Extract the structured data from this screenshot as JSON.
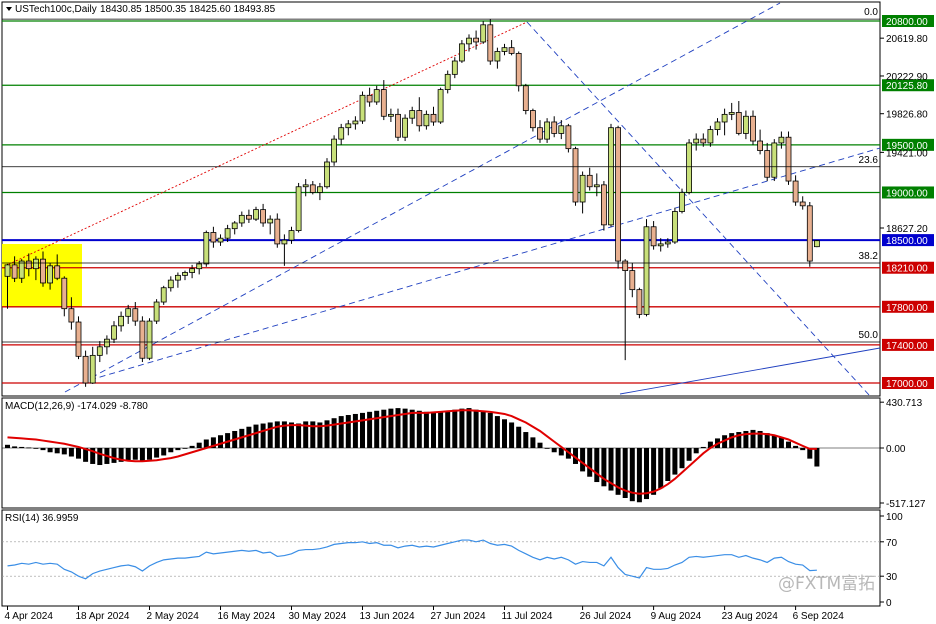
{
  "header": {
    "symbol": "USTech100c,Daily",
    "ohlc": "18430.85 18500.35 18425.60 18493.85"
  },
  "price_axis": {
    "ticks": [
      "20619.80",
      "20222.90",
      "19826.80",
      "19421.00",
      "18627.20"
    ]
  },
  "price_levels": [
    {
      "label": "20800.00",
      "value": 20800.0,
      "color": "#008000",
      "style": "green"
    },
    {
      "label": "20125.80",
      "value": 20125.8,
      "color": "#008000",
      "style": "green"
    },
    {
      "label": "19500.00",
      "value": 19500.0,
      "color": "#008000",
      "style": "green"
    },
    {
      "label": "19000.00",
      "value": 19000.0,
      "color": "#008000",
      "style": "green"
    },
    {
      "label": "18500.00",
      "value": 18500.0,
      "color": "#0000cd",
      "style": "blue"
    },
    {
      "label": "18210.00",
      "value": 18210.0,
      "color": "#cc0000",
      "style": "red"
    },
    {
      "label": "17800.00",
      "value": 17800.0,
      "color": "#cc0000",
      "style": "red"
    },
    {
      "label": "17400.00",
      "value": 17400.0,
      "color": "#cc0000",
      "style": "red"
    },
    {
      "label": "17000.00",
      "value": 17000.0,
      "color": "#cc0000",
      "style": "red"
    }
  ],
  "fib_levels": [
    {
      "label": "0.0",
      "value": 20820.0
    },
    {
      "label": "23.6",
      "value": 19270.0
    },
    {
      "label": "38.2",
      "value": 18260.0
    },
    {
      "label": "50.0",
      "value": 17430.0
    }
  ],
  "macd": {
    "title": "MACD(12,26,9) -174.029 -8.780",
    "ticks": [
      "430.713",
      "0.00",
      "-517.127"
    ],
    "ylim": [
      -600,
      500
    ]
  },
  "rsi": {
    "title": "RSI(14) 36.9959",
    "ticks": [
      "100",
      "70",
      "30",
      "0"
    ],
    "ylim": [
      0,
      100
    ]
  },
  "date_labels": [
    {
      "label": "4 Apr 2024",
      "index": 0
    },
    {
      "label": "18 Apr 2024",
      "index": 10
    },
    {
      "label": "2 May 2024",
      "index": 20
    },
    {
      "label": "16 May 2024",
      "index": 30
    },
    {
      "label": "30 May 2024",
      "index": 40
    },
    {
      "label": "13 Jun 2024",
      "index": 50
    },
    {
      "label": "27 Jun 2024",
      "index": 60
    },
    {
      "label": "11 Jul 2024",
      "index": 70
    },
    {
      "label": "26 Jul 2024",
      "index": 81
    },
    {
      "label": "9 Aug 2024",
      "index": 91
    },
    {
      "label": "23 Aug 2024",
      "index": 101
    },
    {
      "label": "6 Sep 2024",
      "index": 111
    }
  ],
  "watermark": "@FXTM富拓",
  "colors": {
    "bull": "#c8e07a",
    "bear": "#e8b090",
    "macd_signal": "#e00000",
    "rsi_line": "#3a8ee6",
    "highlight": "#ffff00"
  },
  "chart_data": {
    "type": "candlestick",
    "series": [
      {
        "name": "USTech100c,Daily",
        "values": [
          [
            18120,
            18250,
            17780,
            18240
          ],
          [
            18240,
            18330,
            18060,
            18100
          ],
          [
            18100,
            18300,
            18050,
            18280
          ],
          [
            18280,
            18360,
            18120,
            18200
          ],
          [
            18200,
            18330,
            18080,
            18300
          ],
          [
            18300,
            18380,
            18010,
            18050
          ],
          [
            18050,
            18260,
            17980,
            18230
          ],
          [
            18230,
            18350,
            18080,
            18100
          ],
          [
            18100,
            18120,
            17700,
            17780
          ],
          [
            17780,
            17900,
            17560,
            17640
          ],
          [
            17640,
            17700,
            17250,
            17280
          ],
          [
            17280,
            17340,
            16960,
            17000
          ],
          [
            17000,
            17380,
            16990,
            17290
          ],
          [
            17290,
            17440,
            17220,
            17380
          ],
          [
            17380,
            17500,
            17300,
            17460
          ],
          [
            17460,
            17650,
            17420,
            17600
          ],
          [
            17600,
            17750,
            17540,
            17700
          ],
          [
            17700,
            17820,
            17620,
            17780
          ],
          [
            17780,
            17850,
            17600,
            17650
          ],
          [
            17650,
            17700,
            17220,
            17260
          ],
          [
            17260,
            17680,
            17240,
            17650
          ],
          [
            17650,
            17880,
            17620,
            17850
          ],
          [
            17850,
            18020,
            17820,
            18000
          ],
          [
            18000,
            18120,
            17960,
            18080
          ],
          [
            18080,
            18160,
            18000,
            18130
          ],
          [
            18130,
            18180,
            18080,
            18160
          ],
          [
            18160,
            18240,
            18100,
            18200
          ],
          [
            18200,
            18280,
            18140,
            18250
          ],
          [
            18250,
            18600,
            18220,
            18580
          ],
          [
            18580,
            18640,
            18420,
            18480
          ],
          [
            18480,
            18560,
            18440,
            18520
          ],
          [
            18520,
            18660,
            18480,
            18620
          ],
          [
            18620,
            18700,
            18560,
            18680
          ],
          [
            18680,
            18800,
            18640,
            18760
          ],
          [
            18760,
            18820,
            18680,
            18720
          ],
          [
            18720,
            18850,
            18700,
            18820
          ],
          [
            18820,
            18880,
            18640,
            18680
          ],
          [
            18680,
            18760,
            18560,
            18720
          ],
          [
            18720,
            18780,
            18420,
            18460
          ],
          [
            18460,
            18560,
            18230,
            18500
          ],
          [
            18500,
            18640,
            18460,
            18600
          ],
          [
            18600,
            19100,
            18580,
            19060
          ],
          [
            19060,
            19140,
            18960,
            19080
          ],
          [
            19080,
            19120,
            18980,
            19000
          ],
          [
            19000,
            19100,
            18920,
            19060
          ],
          [
            19060,
            19360,
            19040,
            19320
          ],
          [
            19320,
            19600,
            19280,
            19560
          ],
          [
            19560,
            19720,
            19500,
            19680
          ],
          [
            19680,
            19760,
            19600,
            19720
          ],
          [
            19720,
            19800,
            19660,
            19750
          ],
          [
            19750,
            20060,
            19720,
            20020
          ],
          [
            20020,
            20100,
            19900,
            19950
          ],
          [
            19950,
            20120,
            19920,
            20080
          ],
          [
            20080,
            20180,
            19760,
            19800
          ],
          [
            19800,
            19880,
            19740,
            19820
          ],
          [
            19820,
            19880,
            19540,
            19580
          ],
          [
            19580,
            19820,
            19540,
            19780
          ],
          [
            19780,
            19900,
            19720,
            19860
          ],
          [
            19860,
            20000,
            19640,
            19700
          ],
          [
            19700,
            19860,
            19660,
            19820
          ],
          [
            19820,
            19900,
            19700,
            19740
          ],
          [
            19740,
            20100,
            19720,
            20080
          ],
          [
            20080,
            20280,
            20040,
            20240
          ],
          [
            20240,
            20420,
            20200,
            20380
          ],
          [
            20380,
            20600,
            20360,
            20560
          ],
          [
            20560,
            20660,
            20480,
            20620
          ],
          [
            20620,
            20700,
            20500,
            20580
          ],
          [
            20580,
            20800,
            20560,
            20760
          ],
          [
            20760,
            20820,
            20340,
            20380
          ],
          [
            20380,
            20520,
            20300,
            20480
          ],
          [
            20480,
            20560,
            20440,
            20520
          ],
          [
            20520,
            20600,
            20440,
            20460
          ],
          [
            20460,
            20480,
            20060,
            20120
          ],
          [
            20120,
            20140,
            19820,
            19860
          ],
          [
            19860,
            19880,
            19640,
            19680
          ],
          [
            19680,
            19760,
            19520,
            19560
          ],
          [
            19560,
            19780,
            19520,
            19740
          ],
          [
            19740,
            19800,
            19580,
            19620
          ],
          [
            19620,
            19760,
            19560,
            19700
          ],
          [
            19700,
            19720,
            19420,
            19460
          ],
          [
            19460,
            19480,
            18860,
            18900
          ],
          [
            18900,
            19220,
            18780,
            19180
          ],
          [
            19180,
            19260,
            19020,
            19060
          ],
          [
            19060,
            19200,
            18960,
            19080
          ],
          [
            19080,
            19120,
            18600,
            18660
          ],
          [
            18660,
            19720,
            18640,
            19680
          ],
          [
            19680,
            19700,
            18200,
            18280
          ],
          [
            18280,
            18300,
            17240,
            18180
          ],
          [
            18180,
            18260,
            17900,
            17980
          ],
          [
            17980,
            18000,
            17680,
            17720
          ],
          [
            17720,
            18720,
            17700,
            18640
          ],
          [
            18640,
            18700,
            18400,
            18440
          ],
          [
            18440,
            18520,
            18380,
            18460
          ],
          [
            18460,
            18520,
            18420,
            18480
          ],
          [
            18480,
            18840,
            18460,
            18800
          ],
          [
            18800,
            19040,
            18780,
            19000
          ],
          [
            19000,
            19560,
            18980,
            19520
          ],
          [
            19520,
            19620,
            19440,
            19560
          ],
          [
            19560,
            19620,
            19480,
            19520
          ],
          [
            19520,
            19700,
            19480,
            19660
          ],
          [
            19660,
            19780,
            19600,
            19740
          ],
          [
            19740,
            19880,
            19600,
            19820
          ],
          [
            19820,
            19940,
            19760,
            19840
          ],
          [
            19840,
            19960,
            19600,
            19620
          ],
          [
            19620,
            19860,
            19560,
            19800
          ],
          [
            19800,
            19860,
            19500,
            19540
          ],
          [
            19540,
            19660,
            19400,
            19440
          ],
          [
            19440,
            19520,
            19120,
            19160
          ],
          [
            19160,
            19560,
            19120,
            19520
          ],
          [
            19520,
            19640,
            19460,
            19580
          ],
          [
            19580,
            19640,
            19080,
            19120
          ],
          [
            19120,
            19180,
            18860,
            18900
          ],
          [
            18900,
            18960,
            18820,
            18860
          ],
          [
            18860,
            18900,
            18220,
            18280
          ],
          [
            18430.85,
            18500.35,
            18425.6,
            18493.85
          ]
        ]
      }
    ],
    "macd_values": [
      30,
      15,
      10,
      5,
      0,
      -20,
      -40,
      -50,
      -60,
      -80,
      -100,
      -130,
      -150,
      -160,
      -150,
      -140,
      -130,
      -120,
      -110,
      -120,
      -110,
      -90,
      -70,
      -40,
      -20,
      0,
      20,
      50,
      80,
      100,
      120,
      140,
      160,
      180,
      200,
      220,
      230,
      240,
      250,
      250,
      240,
      230,
      250,
      250,
      240,
      260,
      280,
      300,
      310,
      320,
      330,
      340,
      350,
      360,
      370,
      375,
      370,
      360,
      350,
      340,
      340,
      345,
      350,
      360,
      370,
      375,
      360,
      350,
      330,
      300,
      270,
      240,
      200,
      150,
      100,
      50,
      0,
      -40,
      -70,
      -100,
      -150,
      -220,
      -270,
      -320,
      -360,
      -400,
      -440,
      -470,
      -500,
      -510,
      -480,
      -440,
      -380,
      -310,
      -250,
      -190,
      -120,
      -50,
      10,
      60,
      90,
      120,
      140,
      150,
      160,
      170,
      160,
      140,
      120,
      100,
      60,
      20,
      -20,
      -100,
      -174
    ],
    "signal_values": [
      100,
      95,
      90,
      85,
      80,
      70,
      60,
      50,
      40,
      25,
      10,
      -10,
      -30,
      -55,
      -75,
      -95,
      -110,
      -120,
      -125,
      -125,
      -120,
      -115,
      -105,
      -95,
      -80,
      -60,
      -40,
      -20,
      0,
      20,
      40,
      60,
      80,
      100,
      120,
      140,
      160,
      180,
      200,
      210,
      215,
      215,
      210,
      205,
      205,
      210,
      220,
      230,
      240,
      250,
      260,
      270,
      280,
      290,
      300,
      310,
      320,
      330,
      330,
      330,
      335,
      340,
      345,
      350,
      355,
      355,
      350,
      345,
      340,
      330,
      320,
      300,
      270,
      240,
      200,
      160,
      110,
      60,
      10,
      -40,
      -90,
      -140,
      -190,
      -240,
      -290,
      -330,
      -370,
      -400,
      -420,
      -430,
      -425,
      -410,
      -380,
      -340,
      -290,
      -230,
      -170,
      -110,
      -50,
      0,
      40,
      70,
      100,
      120,
      130,
      135,
      135,
      130,
      120,
      100,
      80,
      50,
      20,
      -8.78,
      -8.78
    ],
    "rsi_values": [
      42,
      43,
      45,
      44,
      46,
      44,
      45,
      44,
      38,
      35,
      30,
      27,
      33,
      36,
      38,
      40,
      42,
      43,
      41,
      36,
      42,
      46,
      49,
      50,
      51,
      51,
      52,
      53,
      58,
      56,
      57,
      58,
      59,
      60,
      59,
      60,
      57,
      58,
      53,
      54,
      56,
      60,
      61,
      61,
      62,
      64,
      67,
      68,
      69,
      69,
      70,
      68,
      69,
      66,
      66,
      63,
      65,
      66,
      64,
      65,
      64,
      66,
      68,
      70,
      72,
      72,
      70,
      72,
      68,
      66,
      67,
      65,
      60,
      56,
      52,
      49,
      52,
      50,
      52,
      49,
      44,
      47,
      46,
      46,
      42,
      52,
      40,
      32,
      30,
      28,
      40,
      38,
      38,
      39,
      43,
      46,
      52,
      53,
      52,
      53,
      54,
      55,
      55,
      52,
      54,
      51,
      49,
      46,
      51,
      52,
      47,
      44,
      43,
      36.5,
      37.0
    ]
  }
}
